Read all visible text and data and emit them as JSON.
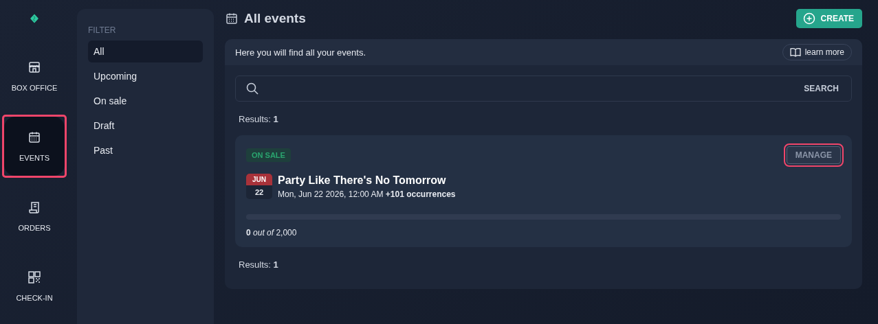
{
  "nav": [
    {
      "label": "BOX OFFICE",
      "kind": "store",
      "selected": false,
      "highlighted": false
    },
    {
      "label": "EVENTS",
      "kind": "calendar",
      "selected": true,
      "highlighted": true
    },
    {
      "label": "ORDERS",
      "kind": "receipt",
      "selected": false,
      "highlighted": false
    },
    {
      "label": "CHECK-IN",
      "kind": "qr",
      "selected": false,
      "highlighted": false
    }
  ],
  "filter": {
    "heading": "FILTER",
    "items": [
      {
        "label": "All",
        "selected": true
      },
      {
        "label": "Upcoming",
        "selected": false
      },
      {
        "label": "On sale",
        "selected": false
      },
      {
        "label": "Draft",
        "selected": false
      },
      {
        "label": "Past",
        "selected": false
      }
    ]
  },
  "page": {
    "title": "All events",
    "create_button": "CREATE"
  },
  "intro": {
    "text": "Here you will find all your events.",
    "learn_more": "learn more"
  },
  "search": {
    "button": "SEARCH"
  },
  "results_top": "Results: **1**",
  "events": [
    {
      "status": "ON SALE",
      "manage": "MANAGE",
      "manage_highlighted": true,
      "month": "JUN",
      "day": "22",
      "title": "Party Like There's No Tomorrow",
      "date": "Mon, Jun 22 2026, 12:00 AM **+101 occurrences**",
      "level": 0,
      "sold": "**0** *out of* 2,000"
    }
  ],
  "results_bottom": "Results: **1**"
}
